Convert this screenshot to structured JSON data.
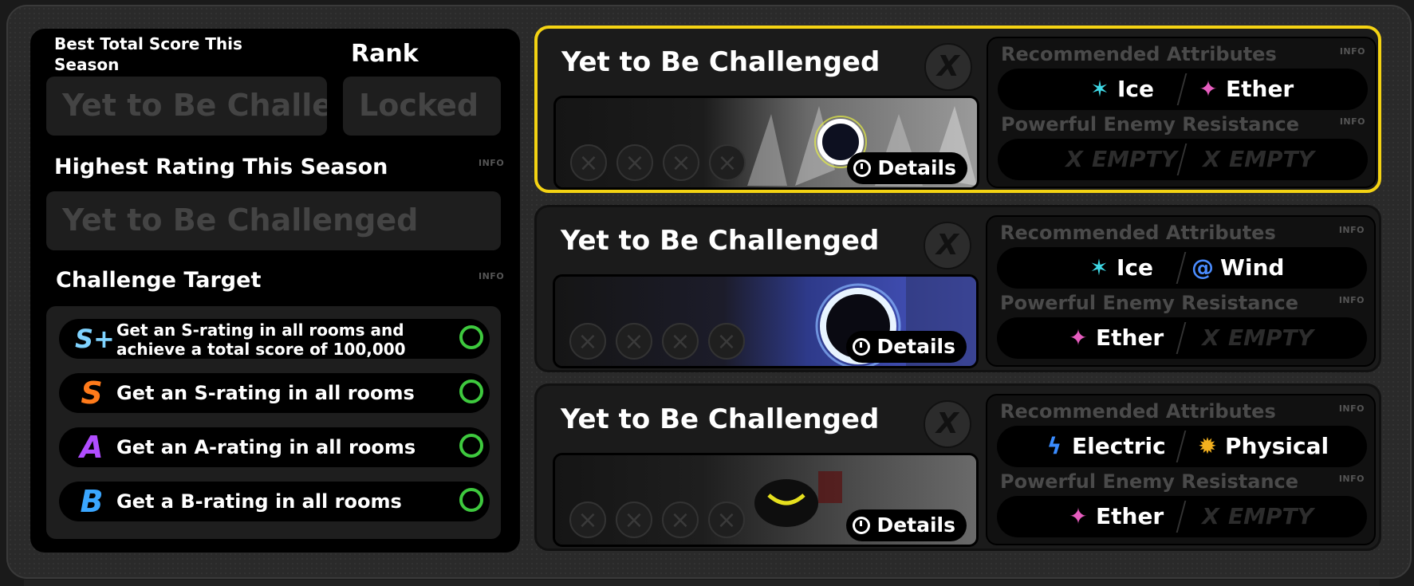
{
  "left_panel": {
    "best_score_label": "Best Total Score This Season",
    "best_score_value": "Yet to Be Challenged",
    "rank_label": "Rank",
    "rank_value": "Locked",
    "highest_rating_label": "Highest Rating This Season",
    "highest_rating_value": "Yet to Be Challenged",
    "info_label": "INFO",
    "challenge_target_label": "Challenge Target",
    "targets": [
      {
        "badge": "S+",
        "text_line1": "Get an S-rating in all rooms and",
        "text_line2": "achieve a total score of 100,000",
        "color": "#7fd3ff"
      },
      {
        "badge": "S",
        "text": "Get an S-rating in all rooms",
        "color": "#ff7a1a"
      },
      {
        "badge": "A",
        "text": "Get an A-rating in all rooms",
        "color": "#b04dff"
      },
      {
        "badge": "B",
        "text": "Get a B-rating in all rooms",
        "color": "#3aa6ff"
      }
    ]
  },
  "cards": [
    {
      "title": "Yet to Be Challenged",
      "close_label": "X",
      "details_label": "Details",
      "slot_label": "×",
      "selected": true,
      "recommended_label": "Recommended Attributes",
      "recommended": [
        {
          "name": "Ice",
          "icon": "✶",
          "color": "#3fd9e6"
        },
        {
          "name": "Ether",
          "icon": "✦",
          "color": "#e65dbf"
        }
      ],
      "resistance_label": "Powerful Enemy Resistance",
      "resistance": [
        {
          "name": "EMPTY",
          "icon": "X",
          "empty": true
        },
        {
          "name": "EMPTY",
          "icon": "X",
          "empty": true
        }
      ],
      "info_label": "INFO"
    },
    {
      "title": "Yet to Be Challenged",
      "close_label": "X",
      "details_label": "Details",
      "slot_label": "×",
      "selected": false,
      "recommended_label": "Recommended Attributes",
      "recommended": [
        {
          "name": "Ice",
          "icon": "✶",
          "color": "#3fd9e6"
        },
        {
          "name": "Wind",
          "icon": "@",
          "color": "#4a8cff"
        }
      ],
      "resistance_label": "Powerful Enemy Resistance",
      "resistance": [
        {
          "name": "Ether",
          "icon": "✦",
          "color": "#e65dbf"
        },
        {
          "name": "EMPTY",
          "icon": "X",
          "empty": true
        }
      ],
      "info_label": "INFO"
    },
    {
      "title": "Yet to Be Challenged",
      "close_label": "X",
      "details_label": "Details",
      "slot_label": "×",
      "selected": false,
      "recommended_label": "Recommended Attributes",
      "recommended": [
        {
          "name": "Electric",
          "icon": "ϟ",
          "color": "#3a8cff"
        },
        {
          "name": "Physical",
          "icon": "✹",
          "color": "#f2b01e"
        }
      ],
      "resistance_label": "Powerful Enemy Resistance",
      "resistance": [
        {
          "name": "Ether",
          "icon": "✦",
          "color": "#e65dbf"
        },
        {
          "name": "EMPTY",
          "icon": "X",
          "empty": true
        }
      ],
      "info_label": "INFO"
    }
  ]
}
